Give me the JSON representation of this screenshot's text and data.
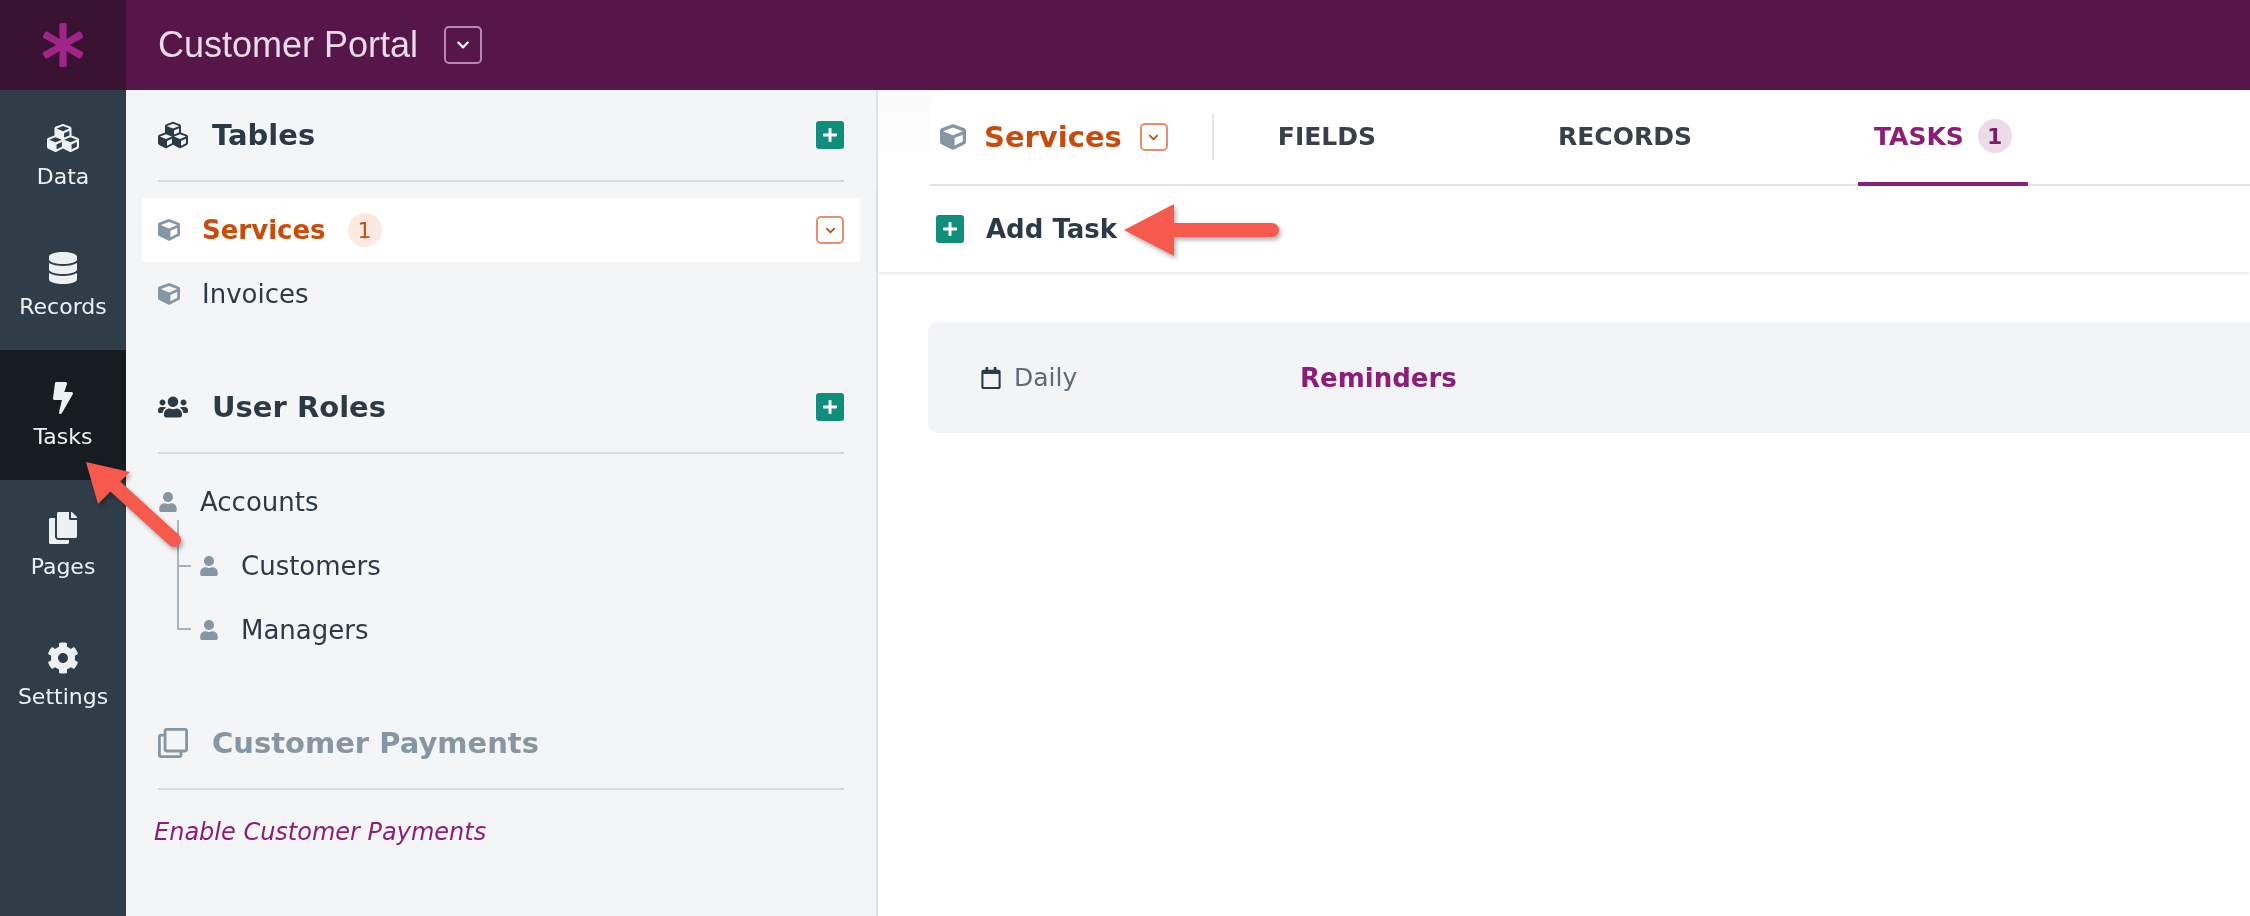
{
  "app": {
    "title": "Customer Portal"
  },
  "nav_rail": [
    {
      "kind": "data",
      "label": "Data",
      "selected": false
    },
    {
      "kind": "records",
      "label": "Records",
      "selected": false
    },
    {
      "kind": "tasks",
      "label": "Tasks",
      "selected": true
    },
    {
      "kind": "pages",
      "label": "Pages",
      "selected": false
    },
    {
      "kind": "settings",
      "label": "Settings",
      "selected": false
    }
  ],
  "sidebar": {
    "sections": [
      {
        "kind": "tables",
        "title": "Tables",
        "disabled": false,
        "items": [
          {
            "label": "Services",
            "badge": "1",
            "selected": true
          },
          {
            "label": "Invoices",
            "selected": false
          }
        ]
      },
      {
        "kind": "roles",
        "title": "User Roles",
        "disabled": false,
        "items": [
          {
            "label": "Accounts",
            "selected": false,
            "children": [
              {
                "label": "Customers",
                "selected": false
              },
              {
                "label": "Managers",
                "selected": false
              }
            ]
          }
        ]
      },
      {
        "kind": "payments",
        "title": "Customer Payments",
        "disabled": true,
        "link": "Enable Customer Payments"
      }
    ]
  },
  "main": {
    "table_name": "Services",
    "tabs": [
      {
        "label": "FIELDS",
        "selected": false
      },
      {
        "label": "RECORDS",
        "selected": false
      },
      {
        "label": "TASKS",
        "badge": "1",
        "selected": true
      }
    ],
    "add_button": "Add Task",
    "tasks": [
      {
        "schedule": "Daily",
        "name": "Reminders"
      }
    ]
  }
}
